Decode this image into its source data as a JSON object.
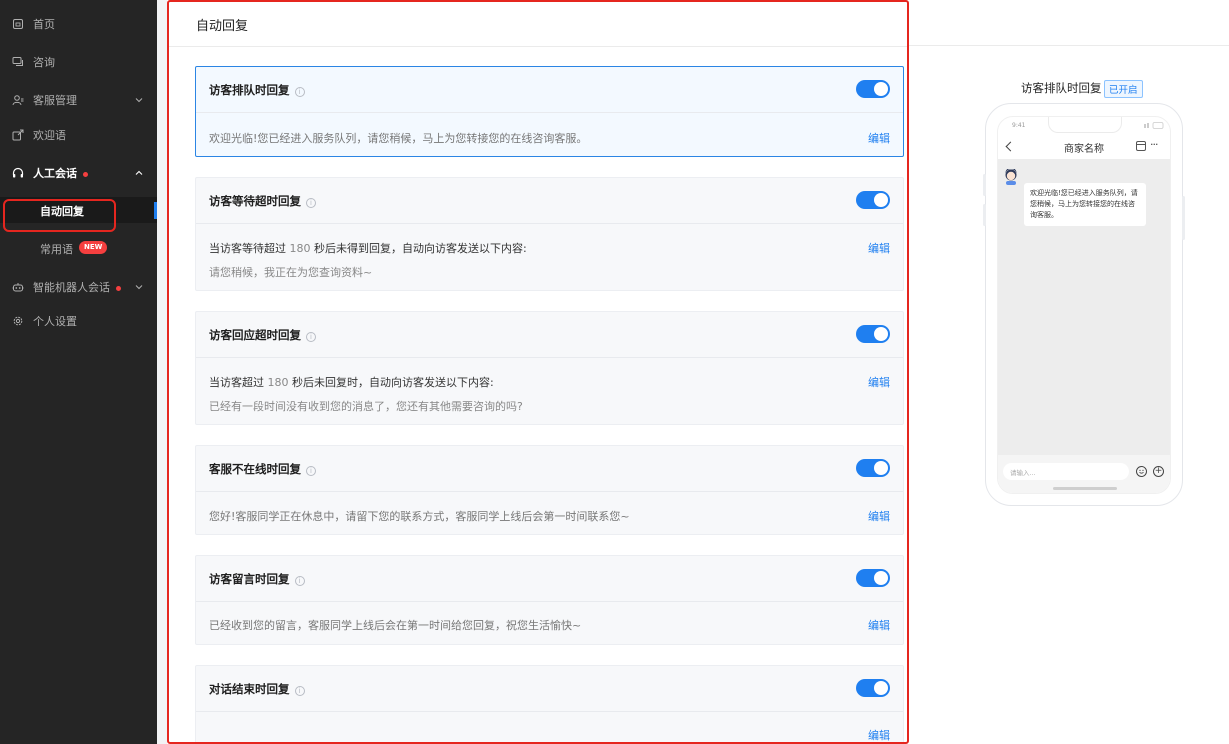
{
  "sidebar": {
    "items": [
      {
        "label": "首页",
        "icon": "home-icon"
      },
      {
        "label": "咨询",
        "icon": "chat-icon"
      },
      {
        "label": "客服管理",
        "icon": "agent-icon"
      },
      {
        "label": "欢迎语",
        "icon": "welcome-icon"
      },
      {
        "label": "人工会话",
        "icon": "headset-icon"
      },
      {
        "label": "智能机器人会话",
        "icon": "robot-icon"
      },
      {
        "label": "个人设置",
        "icon": "gear-icon"
      }
    ],
    "sub_items": [
      {
        "label": "自动回复"
      },
      {
        "label": "常用语",
        "badge": "NEW"
      }
    ]
  },
  "main": {
    "title": "自动回复",
    "cards": [
      {
        "title": "访客排队时回复",
        "line1": "欢迎光临!您已经进入服务队列，请您稍候，马上为您转接您的在线咨询客服。",
        "edit": "编辑",
        "enabled": true
      },
      {
        "title": "访客等待超时回复",
        "prefix": "当访客等待超过",
        "seconds": "180",
        "suffix": "秒后未得到回复，自动向访客发送以下内容:",
        "line2": "请您稍候，我正在为您查询资料~",
        "edit": "编辑",
        "enabled": true
      },
      {
        "title": "访客回应超时回复",
        "prefix": "当访客超过",
        "seconds": "180",
        "suffix": "秒后未回复时，自动向访客发送以下内容:",
        "line2": "已经有一段时间没有收到您的消息了，您还有其他需要咨询的吗?",
        "edit": "编辑",
        "enabled": true
      },
      {
        "title": "客服不在线时回复",
        "line1": "您好!客服同学正在休息中，请留下您的联系方式，客服同学上线后会第一时间联系您~",
        "edit": "编辑",
        "enabled": true
      },
      {
        "title": "访客留言时回复",
        "line1": "已经收到您的留言，客服同学上线后会在第一时间给您回复，祝您生活愉快~",
        "edit": "编辑",
        "enabled": true
      },
      {
        "title": "对话结束时回复",
        "edit": "编辑",
        "enabled": true
      }
    ]
  },
  "preview": {
    "label": "访客排队时回复",
    "badge": "已开启",
    "time": "9:41",
    "chat_title": "商家名称",
    "message": "欢迎光临!您已经进入服务队列，请您稍候，马上为您转接您的在线咨询客服。",
    "input_placeholder": "请输入..."
  },
  "colors": {
    "accent": "#1f7ff0",
    "highlight": "#e5261f",
    "sidebar_bg": "#252525"
  }
}
